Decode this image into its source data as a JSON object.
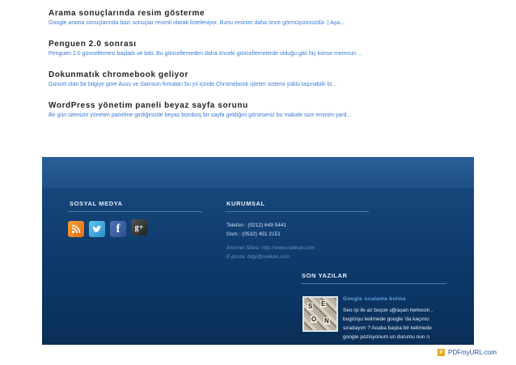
{
  "posts": [
    {
      "title": "Arama sonuçlarında resim gösterme",
      "excerpt": "Google arama sonuçlarında bazı sonuçlar resimli olarak listeleniyor. Bunu eminim daha önce görmüşsünüzdür. | Aşa..."
    },
    {
      "title": "Penguen 2.0 sonrası",
      "excerpt": "Penguen 2.0 güncellemesi başladı ve bitti. Bu güncellemeden daha önceki güncellemelerde olduğu gibi hiç kimse memnun ..."
    },
    {
      "title": "Dokunmatık chromebook geliyor",
      "excerpt": "Güncel olan bir bilgiye göre Asus ve Samsun firmaları bu yıl içinde Chromebook işletim sistemi yüklü taşınabilir bi..."
    },
    {
      "title": "WordPress yönetim paneli beyaz sayfa sorunu",
      "excerpt": "Bir gün sitenizin yönetim paneline girdiğinizde beyaz bomboş bir sayfa geldiğini görürseniz bu makale size eminim yard..."
    }
  ],
  "footer": {
    "social_heading": "SOSYAL MEDYA",
    "social_icons": [
      "rss-icon",
      "twitter-icon",
      "facebook-icon",
      "google-plus-icon"
    ],
    "corporate_heading": "KURUMSAL",
    "phone": "Telefon : (0212) 649 5441",
    "gsm": "Gsm : (0532) 451 2151",
    "website": "İnternet Sitesi: http://www.celikan.com",
    "email": "E-posta: bilgi@celikan.com",
    "recent_heading": "SON YAZILAR",
    "recent_title": "Google sıralama bulma",
    "recent_lines": [
      "Seo işi ile az buçuk uğraşan herkesin ,",
      "bugünşu kelimede google 'da kaçıncı",
      "sıradayım ? Acaba başka bir kelimede",
      "google pozisyonum un durumu nun n"
    ],
    "thumb_letters": [
      "S",
      "E",
      "O",
      "N"
    ]
  },
  "watermark": {
    "icon": "pdfmyurl-icon",
    "text": "PDFmyURL.com"
  }
}
